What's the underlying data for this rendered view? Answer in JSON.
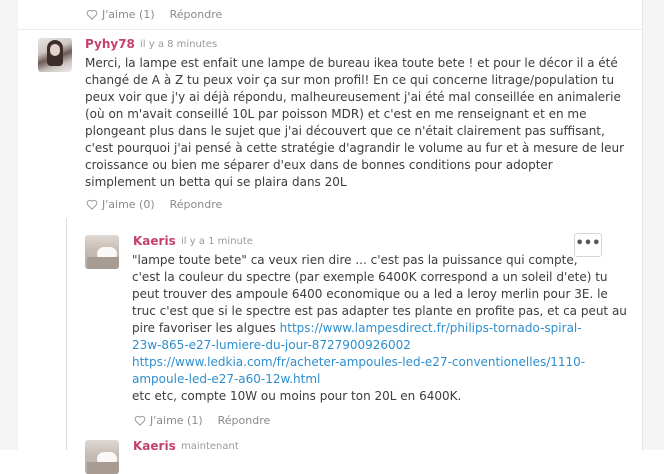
{
  "top_actions": {
    "like_label": "J'aime (1)",
    "reply_label": "Répondre"
  },
  "comment1": {
    "author": "Pyhy78",
    "time": "il y a 8 minutes",
    "lines": [
      "Merci, la lampe est enfait une lampe de bureau ikea toute bete ! et pour le décor il a été",
      "changé de A à Z tu peux voir ça sur mon profil! En ce qui concerne litrage/population tu",
      "peux voir que j'y ai déjà répondu, malheureusement j'ai été mal conseillée en animalerie",
      "(où on m'avait conseillé 10L par poisson MDR) et c'est en me renseignant et en me",
      "plongeant plus dans le sujet que j'ai découvert que ce n'était clairement pas suffisant,",
      "c'est pourquoi j'ai pensé à cette stratégie d'agrandir le volume au fur et à mesure de leur",
      "croissance ou bien me séparer d'eux dans de bonnes conditions pour adopter",
      "simplement un betta qui se plaira dans 20L"
    ],
    "like_label": "J'aime (0)",
    "reply_label": "Répondre"
  },
  "comment2": {
    "author": "Kaeris",
    "time": "il y a 1 minute",
    "more_label": "•••",
    "lines": [
      "\"lampe toute bete\" ca veux rien dire ... c'est pas la puissance qui compte,",
      "c'est la couleur du spectre (par exemple 6400K correspond a un soleil d'ete) tu",
      "peut trouver des ampoule 6400 economique ou a led a leroy merlin pour 3E. le",
      "truc c'est que si le spectre est pas adapter tes plante en profite pas, et ca peut au"
    ],
    "line5_text": "pire favoriser les algues ",
    "link1_a": "https://www.lampesdirect.fr/philips-tornado-spiral-",
    "link1_b": "23w-865-e27-lumiere-du-jour-8727900926002",
    "link2_a": "https://www.ledkia.com/fr/acheter-ampoules-led-e27-conventionelles/1110-",
    "link2_b": "ampoule-led-e27-a60-12w.html",
    "last_line": "etc etc, compte 10W ou moins pour ton 20L en 6400K.",
    "like_label": "J'aime (1)",
    "reply_label": "Répondre"
  },
  "comment3": {
    "author": "Kaeris",
    "time": "maintenant"
  },
  "colors": {
    "author": "#c4416b",
    "link": "#2d8fcf",
    "muted": "#8a8a8a"
  },
  "icons": {
    "like": "heart-outline-icon",
    "more": "more-horizontal-icon"
  }
}
